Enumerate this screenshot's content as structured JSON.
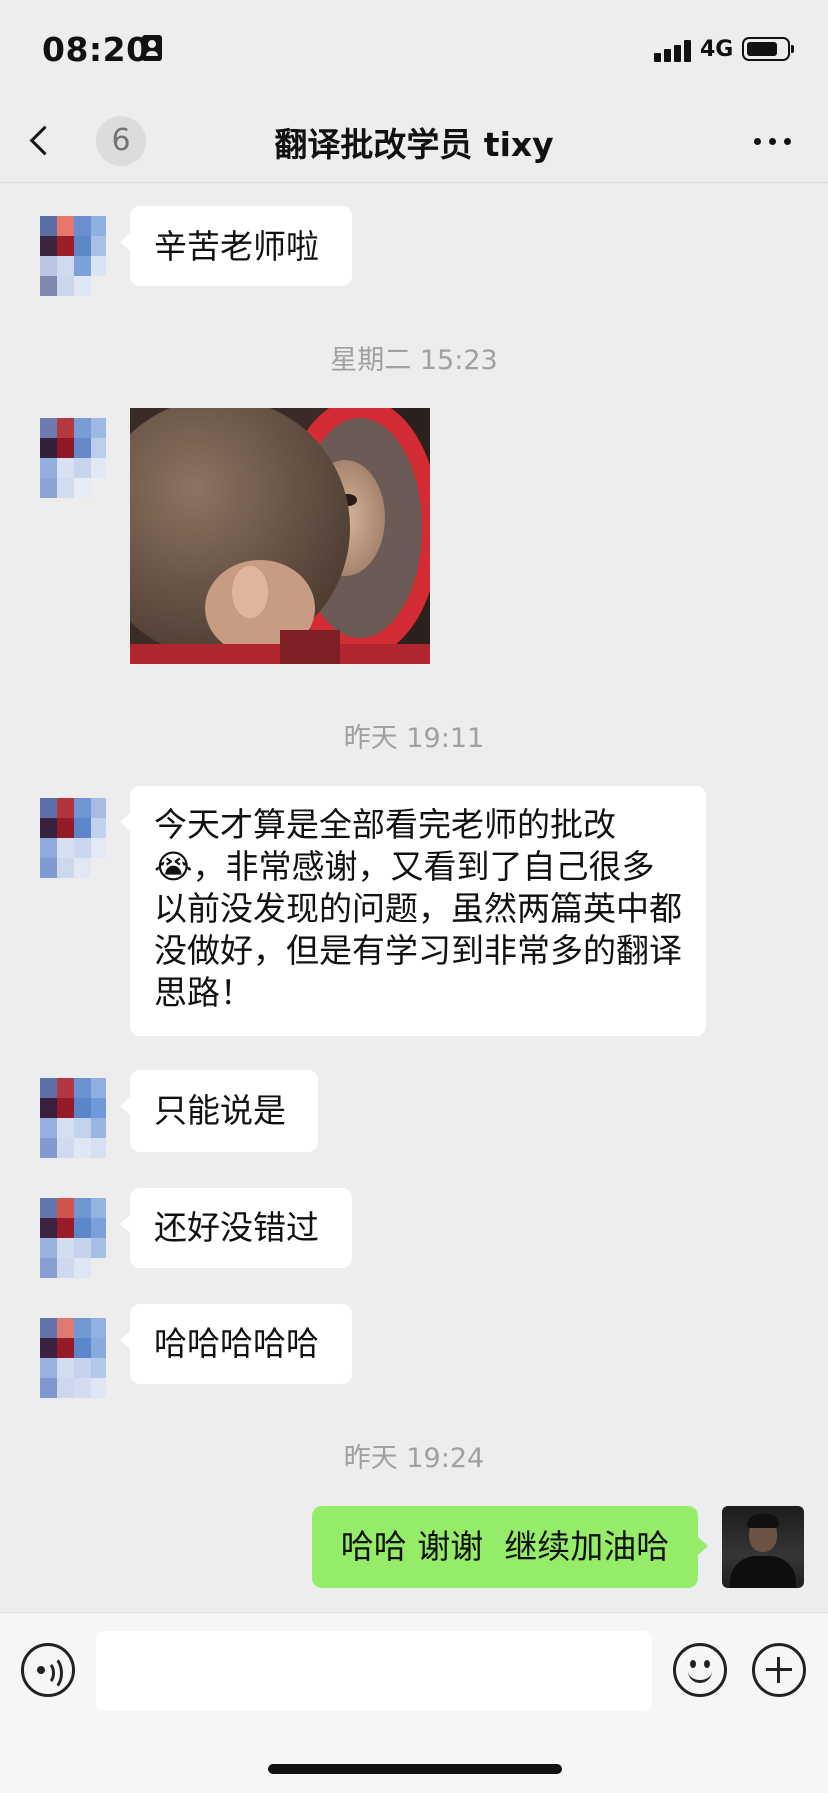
{
  "status_bar": {
    "time": "08:20",
    "network": "4G"
  },
  "nav": {
    "back_count": "6",
    "title": "翻译批改学员 tixy"
  },
  "messages": {
    "m1": "辛苦老师啦",
    "m2": "今天才算是全部看完老师的批改😭，非常感谢，又看到了自己很多以前没发现的问题，虽然两篇英中都没做好，但是有学习到非常多的翻译思路！",
    "m3": "只能说是",
    "m4": "还好没错过",
    "m5": "哈哈哈哈哈",
    "out1": "哈哈 谢谢  继续加油哈"
  },
  "timestamps": {
    "t1": "星期二 15:23",
    "t2": "昨天 19:11",
    "t3": "昨天 19:24"
  },
  "icons": {
    "back": "chevron-left-icon",
    "more": "more-dots-icon",
    "voice": "voice-icon",
    "emoji": "emoji-icon",
    "plus": "plus-icon"
  },
  "colors": {
    "background": "#ededed",
    "incoming_bubble": "#ffffff",
    "outgoing_bubble": "#95ec69",
    "timestamp": "#a0a0a0"
  }
}
